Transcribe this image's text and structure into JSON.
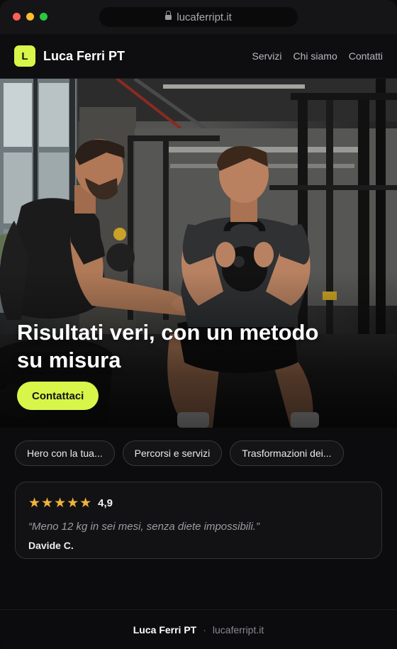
{
  "browser": {
    "url": "lucaferript.it",
    "traffic_lights": [
      "#ff5f57",
      "#febc2e",
      "#28c840"
    ]
  },
  "header": {
    "logo_letter": "L",
    "brand": "Luca Ferri PT",
    "nav": [
      "Servizi",
      "Chi siamo",
      "Contatti"
    ]
  },
  "hero": {
    "title": "Risultati veri, con un metodo su misura",
    "cta_label": "Contattaci",
    "image_description": "gym-photo"
  },
  "chips": [
    "Hero con la tua...",
    "Percorsi e servizi",
    "Trasformazioni dei..."
  ],
  "review": {
    "stars": "★★★★★",
    "score": "4,9",
    "quote": "“Meno 12 kg in sei mesi, senza diete impossibili.”",
    "author": "Davide C."
  },
  "footer": {
    "brand": "Luca Ferri PT",
    "separator": "·",
    "url": "lucaferript.it"
  },
  "colors": {
    "accent": "#d8f54a",
    "star": "#f0b43a",
    "background": "#0c0c0e"
  }
}
